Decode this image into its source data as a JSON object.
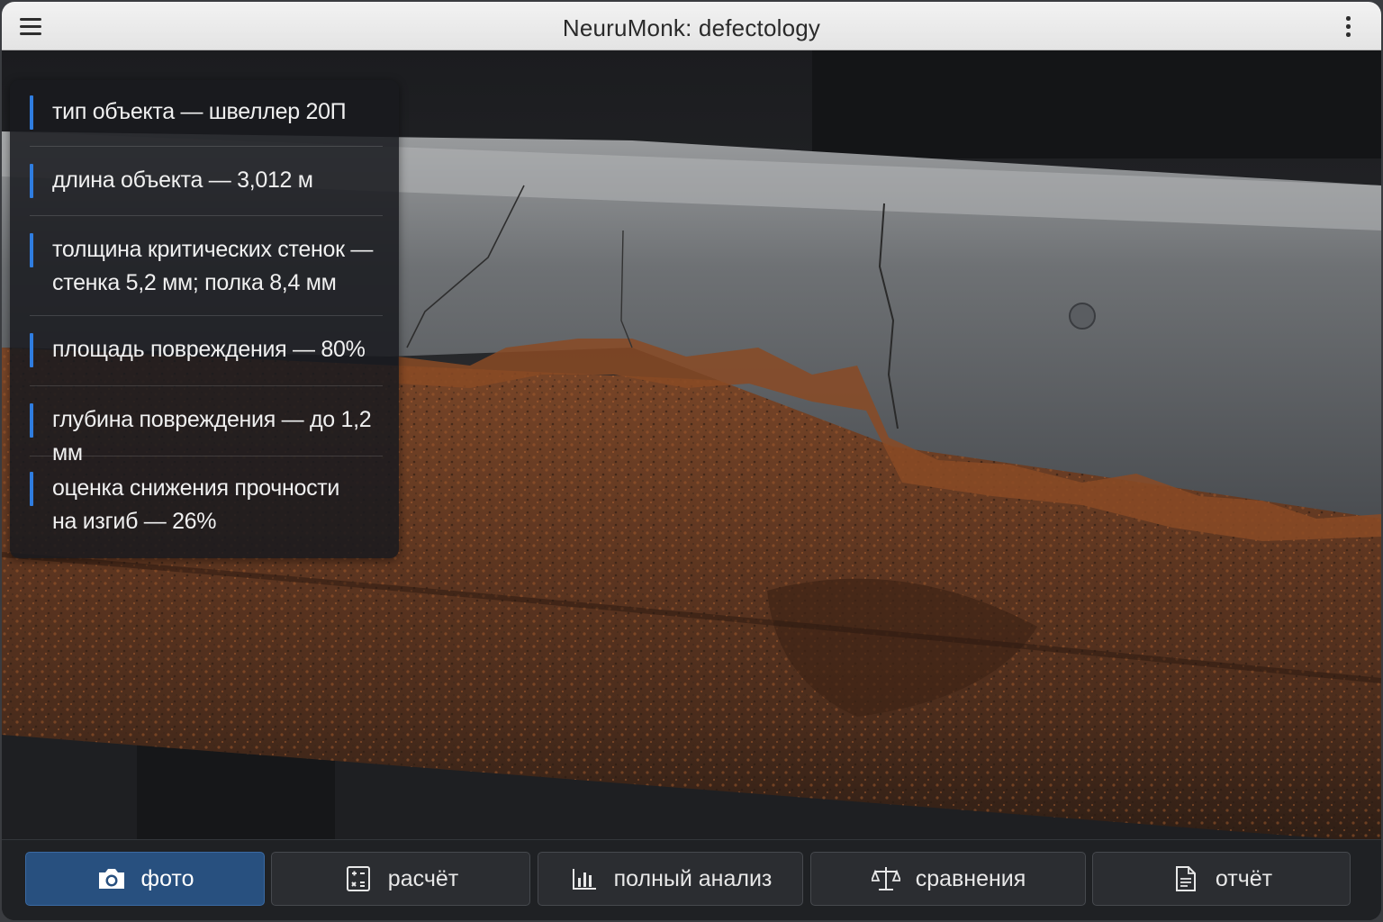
{
  "window": {
    "title": "NeuruMonk: defectology"
  },
  "info_panel": {
    "items": [
      {
        "text": "тип объекта — швеллер 20П"
      },
      {
        "text": "длина объекта — 3,012 м"
      },
      {
        "text": "толщина критических стенок —\nстенка 5,2 мм; полка 8,4 мм"
      },
      {
        "text": "площадь повреждения — 80%"
      },
      {
        "text": "глубина повреждения — до 1,2 мм"
      },
      {
        "text": "оценка снижения прочности\nна изгиб — 26%"
      }
    ],
    "accent_color": "#2f7de0"
  },
  "toolbar": {
    "buttons": [
      {
        "label": "фото",
        "icon": "camera-icon",
        "active": true
      },
      {
        "label": "расчёт",
        "icon": "calculator-icon",
        "active": false
      },
      {
        "label": "полный анализ",
        "icon": "bar-chart-icon",
        "active": false
      },
      {
        "label": "сравнения",
        "icon": "scales-icon",
        "active": false
      },
      {
        "label": "отчёт",
        "icon": "document-icon",
        "active": false
      }
    ]
  },
  "photo": {
    "subject": "rusted steel channel beam"
  }
}
